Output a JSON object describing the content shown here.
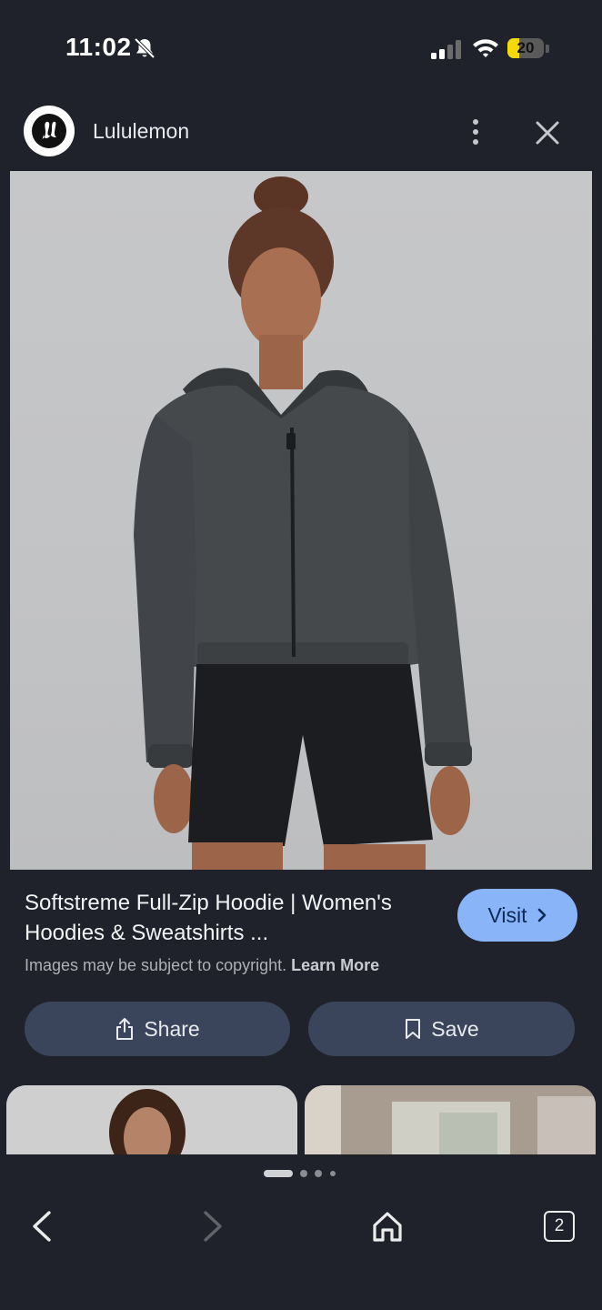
{
  "status_bar": {
    "time": "11:02",
    "battery_level": "20",
    "battery_fraction": 0.2,
    "icons": [
      "bell-slash-icon",
      "cellular-signal-icon",
      "wifi-icon",
      "battery-icon"
    ]
  },
  "header": {
    "site_name": "Lululemon",
    "logo_icon": "lululemon-logo",
    "more_icon": "more-vertical-icon",
    "close_icon": "close-icon"
  },
  "product": {
    "title": "Softstreme Full-Zip Hoodie | Women's Hoodies & Sweatshirts ...",
    "visit_label": "Visit",
    "copyright_notice": "Images may be subject to copyright.",
    "learn_more_label": "Learn More"
  },
  "actions": {
    "share_label": "Share",
    "save_label": "Save"
  },
  "bottom_nav": {
    "tab_count": "2",
    "page_indicator_active": 1,
    "page_indicator_total": 4
  },
  "colors": {
    "background": "#20222b",
    "visit_button": "#8ab4f8",
    "action_button": "#3a455b",
    "battery_fill": "#f5d90a"
  }
}
